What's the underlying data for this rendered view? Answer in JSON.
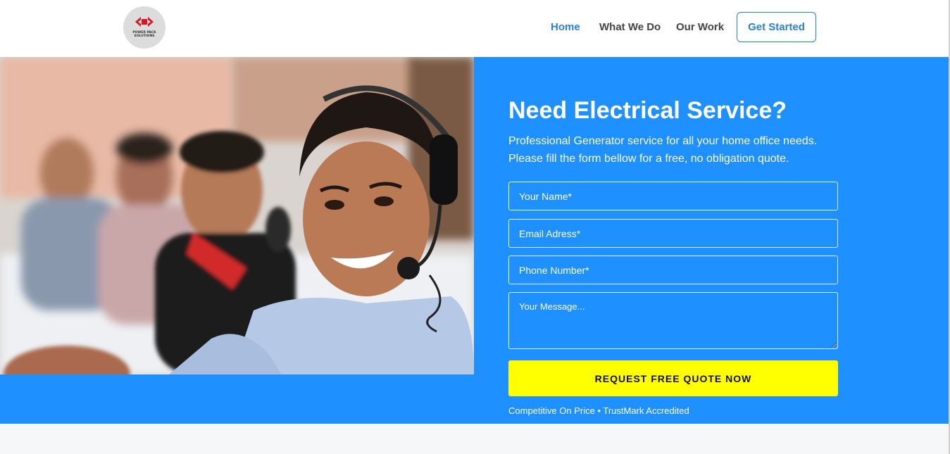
{
  "header": {
    "logo_text": "POWER PACK SOLUTIONS",
    "nav": [
      "Home",
      "What We Do",
      "Our Work"
    ],
    "active": "Home",
    "cta_label": "Get Started"
  },
  "hero": {
    "headline": "Need Electrical Service?",
    "subtext_line1": "Professional Generator service for all your home office needs.",
    "subtext_line2": "Please fill the form bellow for a free, no obligation quote.",
    "form": {
      "name_placeholder": "Your Name*",
      "email_placeholder": "Email Adress*",
      "phone_placeholder": "Phone Number*",
      "message_placeholder": "Your Message...",
      "submit_label": "REQUEST FREE QUOTE NOW"
    },
    "note": "Competitive On Price • TrustMark Accredited"
  },
  "colors": {
    "accent": "#2a80d4",
    "hero_bg": "#1e90ff",
    "submit_bg": "#ffff00"
  }
}
